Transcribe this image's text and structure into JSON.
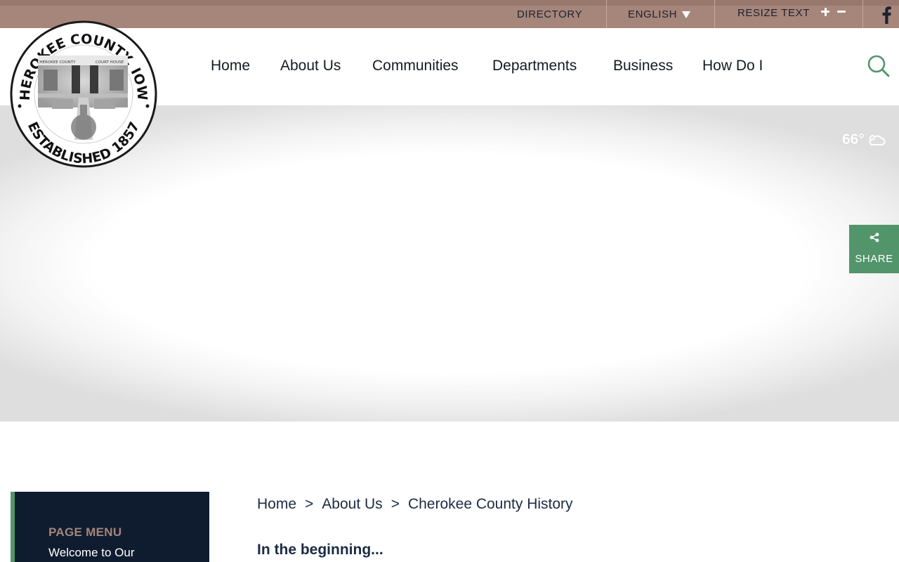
{
  "topbar": {
    "directory_label": "DIRECTORY",
    "language_label": "ENGLISH",
    "resize_label": "RESIZE TEXT",
    "facebook_icon": "facebook-icon",
    "caret_icon": "triangle-down-icon",
    "plus_icon": "plus-icon",
    "minus_icon": "minus-icon"
  },
  "logo": {
    "ring_text_top": "CHEROKEE COUNTY, IOWA",
    "ring_text_bottom": "ESTABLISHED 1857",
    "building_text_left": "CHEROKEE COUNTY",
    "building_text_right": "COURT HOUSE"
  },
  "nav": {
    "items": [
      {
        "label": "Home"
      },
      {
        "label": "About Us"
      },
      {
        "label": "Communities"
      },
      {
        "label": "Departments"
      },
      {
        "label": "Business"
      },
      {
        "label": "How Do I"
      }
    ],
    "search_icon": "search-icon"
  },
  "weather": {
    "temp": "66°",
    "icon": "partly-cloudy-icon"
  },
  "share": {
    "label": "SHARE",
    "icon": "share-icon"
  },
  "page_menu": {
    "title": "PAGE MENU",
    "items": [
      {
        "label": "Welcome to Our"
      }
    ]
  },
  "breadcrumb": {
    "items": [
      "Home",
      "About Us",
      "Cherokee County History"
    ],
    "separator": ">"
  },
  "content": {
    "heading": "In the beginning..."
  },
  "colors": {
    "topbar": "#a6857a",
    "accent_green": "#53956b",
    "navy": "#0f1c30",
    "text_dark": "#1c2c44"
  }
}
